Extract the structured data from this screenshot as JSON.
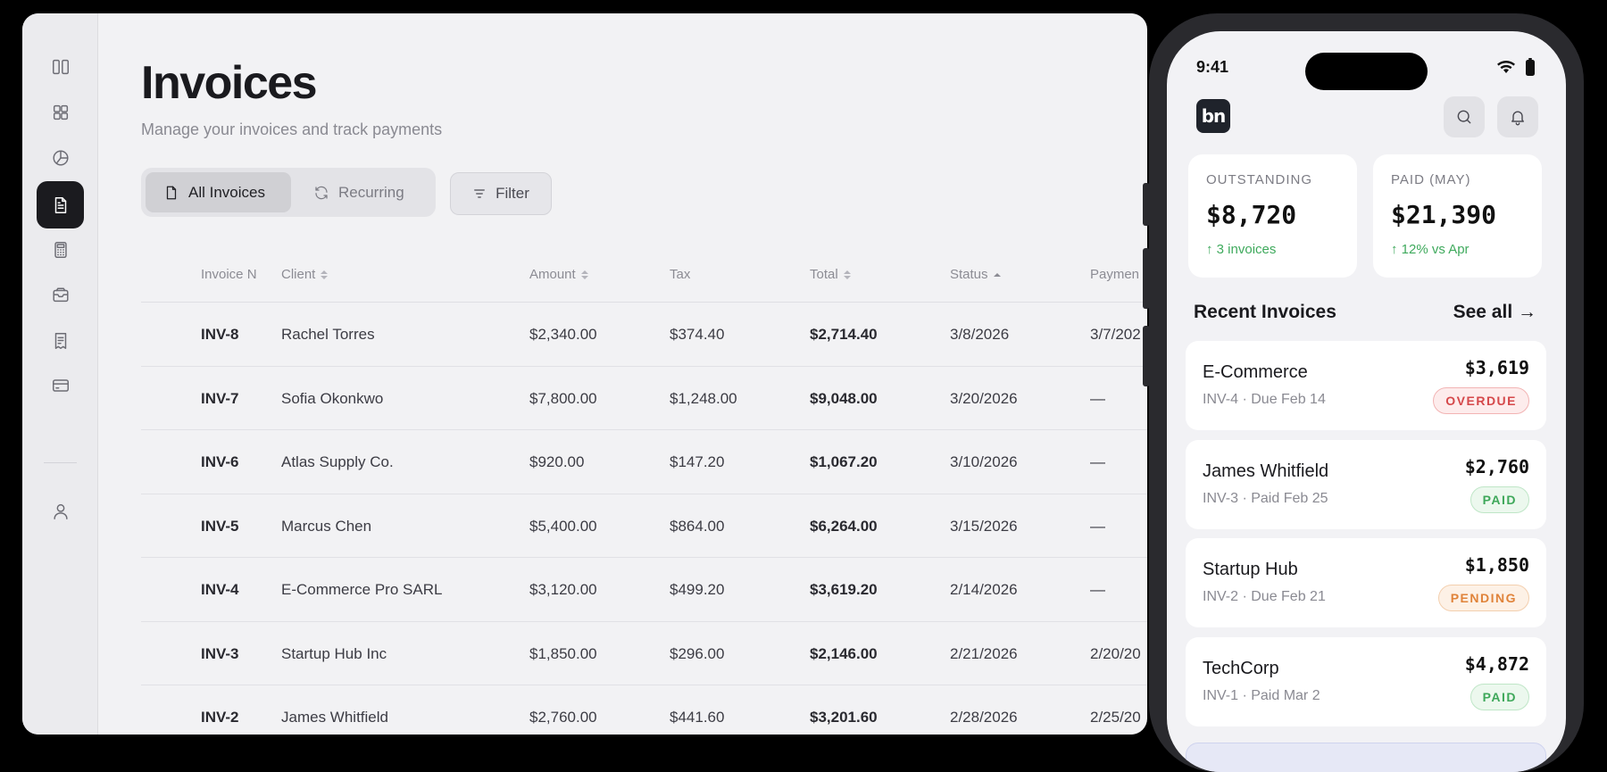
{
  "desktop": {
    "rail": {
      "items": [
        {
          "name": "panel-toggle-icon"
        },
        {
          "name": "dashboard-icon"
        },
        {
          "name": "pie-chart-icon"
        },
        {
          "name": "invoice-document-icon",
          "active": true
        },
        {
          "name": "calculator-icon"
        },
        {
          "name": "inbox-icon"
        },
        {
          "name": "receipt-icon"
        },
        {
          "name": "credit-card-icon"
        },
        {
          "name": "user-icon"
        }
      ]
    },
    "header": {
      "title": "Invoices",
      "subtitle": "Manage your invoices and track payments"
    },
    "tabs": {
      "all": "All Invoices",
      "recurring": "Recurring",
      "active": "all"
    },
    "filter_label": "Filter",
    "table": {
      "columns": [
        "Invoice N",
        "Client",
        "Amount",
        "Tax",
        "Total",
        "Status",
        "Paymen"
      ],
      "rows": [
        {
          "id": "INV-8",
          "client": "Rachel Torres",
          "amount": "$2,340.00",
          "tax": "$374.40",
          "total": "$2,714.40",
          "status": "3/8/2026",
          "payment": "3/7/202"
        },
        {
          "id": "INV-7",
          "client": "Sofia Okonkwo",
          "amount": "$7,800.00",
          "tax": "$1,248.00",
          "total": "$9,048.00",
          "status": "3/20/2026",
          "payment": "—"
        },
        {
          "id": "INV-6",
          "client": "Atlas Supply Co.",
          "amount": "$920.00",
          "tax": "$147.20",
          "total": "$1,067.20",
          "status": "3/10/2026",
          "payment": "—"
        },
        {
          "id": "INV-5",
          "client": "Marcus Chen",
          "amount": "$5,400.00",
          "tax": "$864.00",
          "total": "$6,264.00",
          "status": "3/15/2026",
          "payment": "—"
        },
        {
          "id": "INV-4",
          "client": "E-Commerce Pro SARL",
          "amount": "$3,120.00",
          "tax": "$499.20",
          "total": "$3,619.20",
          "status": "2/14/2026",
          "payment": "—"
        },
        {
          "id": "INV-3",
          "client": "Startup Hub Inc",
          "amount": "$1,850.00",
          "tax": "$296.00",
          "total": "$2,146.00",
          "status": "2/21/2026",
          "payment": "2/20/20"
        },
        {
          "id": "INV-2",
          "client": "James Whitfield",
          "amount": "$2,760.00",
          "tax": "$441.60",
          "total": "$3,201.60",
          "status": "2/28/2026",
          "payment": "2/25/20"
        }
      ]
    }
  },
  "phone": {
    "time": "9:41",
    "logo": "bn",
    "stats": [
      {
        "label": "OUTSTANDING",
        "value": "$8,720",
        "delta": "↑ 3 invoices"
      },
      {
        "label": "PAID (MAY)",
        "value": "$21,390",
        "delta": "↑ 12% vs Apr"
      }
    ],
    "recent_title": "Recent Invoices",
    "see_all": "See all →",
    "invoices": [
      {
        "name": "E-Commerce",
        "meta": "INV-4 · Due Feb 14",
        "amount": "$3,619",
        "status": "OVERDUE"
      },
      {
        "name": "James Whitfield",
        "meta": "INV-3 · Paid Feb 25",
        "amount": "$2,760",
        "status": "PAID"
      },
      {
        "name": "Startup Hub",
        "meta": "INV-2 · Due Feb 21",
        "amount": "$1,850",
        "status": "PENDING"
      },
      {
        "name": "TechCorp",
        "meta": "INV-1 · Paid Mar 2",
        "amount": "$4,872",
        "status": "PAID"
      }
    ]
  }
}
